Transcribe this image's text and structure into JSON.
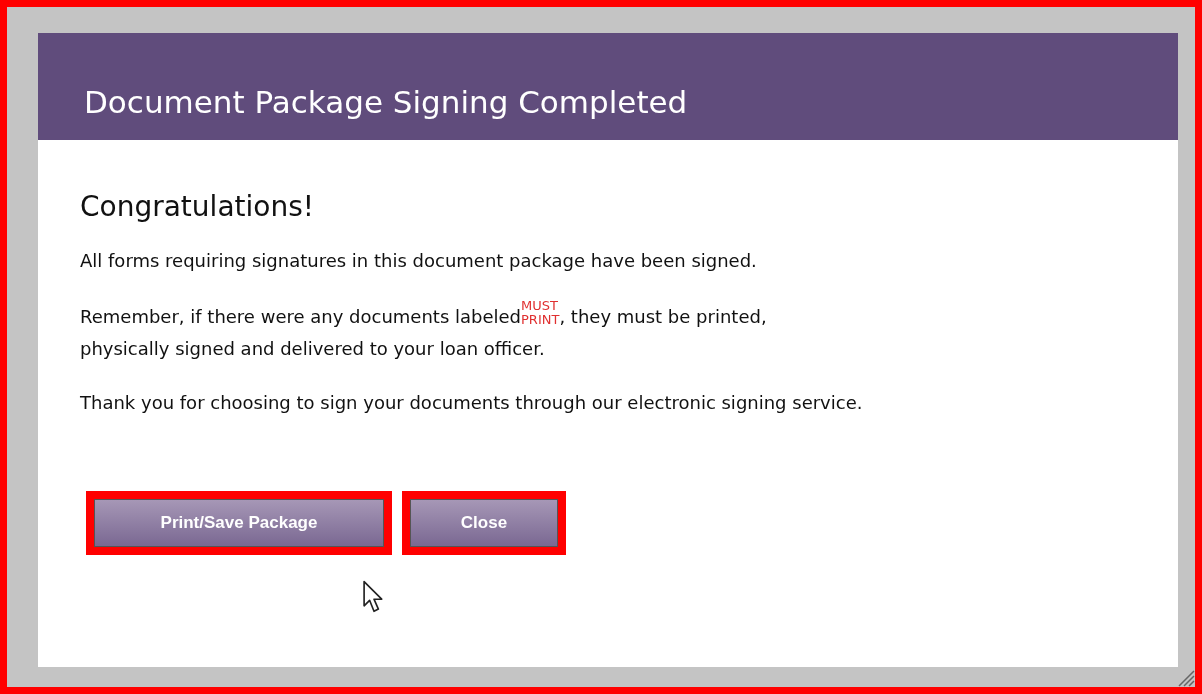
{
  "dialog": {
    "title": "Document Package Signing Completed",
    "heading": "Congratulations!",
    "message": "All forms requiring signatures in this document package have been signed.",
    "reminder": {
      "before": "Remember, if there were any documents labeled",
      "badge": [
        "MUST",
        "PRINT"
      ],
      "after": ", they must be printed,",
      "line_2": "physically signed and delivered to your loan officer."
    },
    "thanks": "Thank you for choosing to sign your documents through our electronic signing service.",
    "buttons": [
      {
        "label": "Print/Save Package",
        "highlighted": true
      },
      {
        "label": "Close",
        "highlighted": true
      }
    ]
  }
}
